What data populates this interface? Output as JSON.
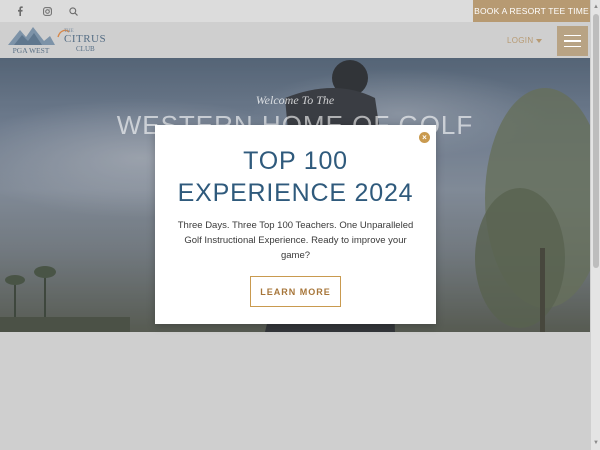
{
  "topbar": {
    "social_icons": [
      "facebook-icon",
      "instagram-icon",
      "search-icon"
    ],
    "book_button_label": "BOOK A RESORT TEE TIME"
  },
  "header": {
    "logo_pga_text": "PGA WEST",
    "logo_citrus_the": "THE",
    "logo_citrus_main": "CITRUS",
    "logo_citrus_club": "CLUB",
    "login_label": "LOGIN",
    "menu_icon": "hamburger-icon"
  },
  "hero": {
    "welcome": "Welcome To The",
    "headline": "WESTERN HOME OF GOLF"
  },
  "modal": {
    "close_icon": "close-icon",
    "title": "TOP 100\nEXPERIENCE 2024",
    "body": "Three Days. Three Top 100 Teachers. One Unparalleled Golf Instructional Experience. Ready to improve your game?",
    "button_label": "LEARN MORE"
  },
  "colors": {
    "accent_gold": "#b79a72",
    "modal_title_blue": "#2f5a7c",
    "button_border": "#c99a4f"
  }
}
